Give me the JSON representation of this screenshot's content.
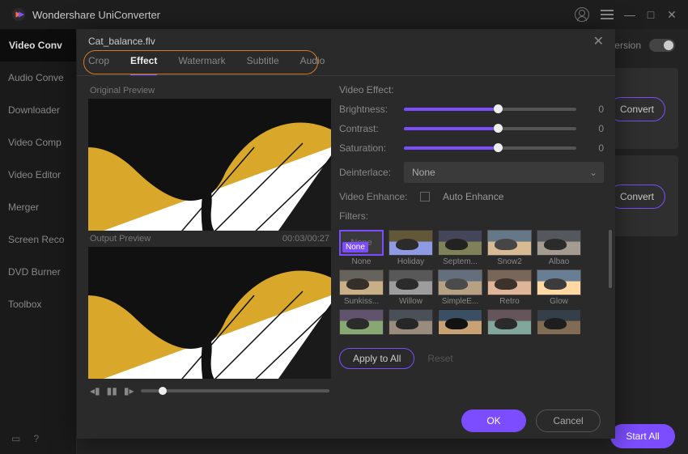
{
  "app": {
    "title": "Wondershare UniConverter"
  },
  "sidebar": {
    "items": [
      {
        "label": "Video Conv"
      },
      {
        "label": "Audio Conve"
      },
      {
        "label": "Downloader"
      },
      {
        "label": "Video Comp"
      },
      {
        "label": "Video Editor"
      },
      {
        "label": "Merger"
      },
      {
        "label": "Screen Reco"
      },
      {
        "label": "DVD Burner"
      },
      {
        "label": "Toolbox"
      }
    ]
  },
  "main": {
    "conversion_label": "Conversion",
    "convert_label": "Convert",
    "start_all": "Start All"
  },
  "modal": {
    "filename": "Cat_balance.flv",
    "tabs": [
      "Crop",
      "Effect",
      "Watermark",
      "Subtitle",
      "Audio"
    ],
    "active_tab": 1,
    "original_label": "Original Preview",
    "output_label": "Output Preview",
    "time": "00:03/00:27",
    "effect_header": "Video Effect:",
    "brightness": {
      "label": "Brightness:",
      "value": 0,
      "pct": 52
    },
    "contrast": {
      "label": "Contrast:",
      "value": 0,
      "pct": 52
    },
    "saturation": {
      "label": "Saturation:",
      "value": 0,
      "pct": 52
    },
    "deinterlace": {
      "label": "Deinterlace:",
      "value": "None"
    },
    "enhance": {
      "label": "Video Enhance:",
      "checkbox": "Auto Enhance"
    },
    "filters_label": "Filters:",
    "filters": [
      {
        "name": "None",
        "selected": true,
        "badge": "None",
        "is_none": true
      },
      {
        "name": "Holiday"
      },
      {
        "name": "Septem..."
      },
      {
        "name": "Snow2"
      },
      {
        "name": "Albao"
      },
      {
        "name": "Sunkiss..."
      },
      {
        "name": "Willow"
      },
      {
        "name": "SimpleE..."
      },
      {
        "name": "Retro"
      },
      {
        "name": "Glow"
      },
      {
        "name": ""
      },
      {
        "name": ""
      },
      {
        "name": ""
      },
      {
        "name": ""
      },
      {
        "name": ""
      }
    ],
    "apply_all": "Apply to All",
    "reset": "Reset",
    "ok": "OK",
    "cancel": "Cancel"
  },
  "colors": {
    "accent": "#7b4dff",
    "ring": "#d67a1f"
  }
}
